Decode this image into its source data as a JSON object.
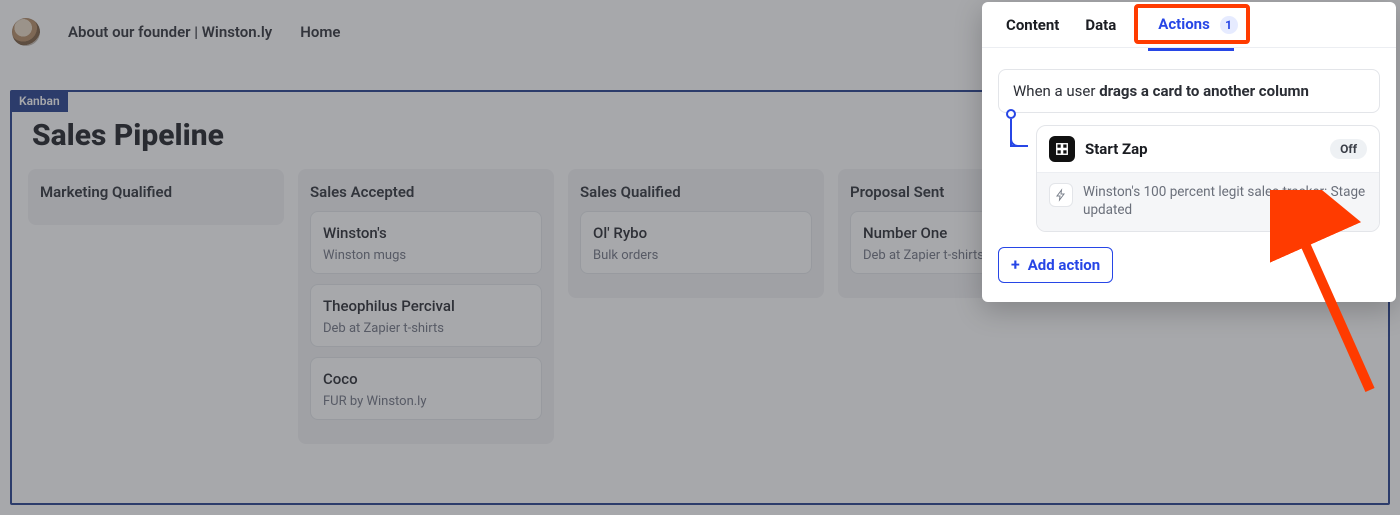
{
  "header": {
    "breadcrumb": "About our founder | Winston.ly",
    "home": "Home"
  },
  "board": {
    "tag": "Kanban",
    "title": "Sales Pipeline",
    "columns": [
      {
        "name": "Marketing Qualified",
        "cards": []
      },
      {
        "name": "Sales Accepted",
        "cards": [
          {
            "title": "Winston's",
            "sub": "Winston mugs"
          },
          {
            "title": "Theophilus Percival",
            "sub": "Deb at Zapier t-shirts"
          },
          {
            "title": "Coco",
            "sub": "FUR by Winston.ly"
          }
        ]
      },
      {
        "name": "Sales Qualified",
        "cards": [
          {
            "title": "Ol' Rybo",
            "sub": "Bulk orders"
          }
        ]
      },
      {
        "name": "Proposal Sent",
        "cards": [
          {
            "title": "Number One",
            "sub": "Deb at Zapier t-shirts"
          }
        ]
      }
    ]
  },
  "panel": {
    "tabs": {
      "content": "Content",
      "data": "Data",
      "actions": "Actions",
      "actions_count": "1"
    },
    "trigger_prefix": "When a user ",
    "trigger_bold": "drags a card to another column",
    "zap": {
      "title": "Start Zap",
      "status": "Off",
      "desc": "Winston's 100 percent legit sales tracker: Stage updated"
    },
    "add_action": "Add action"
  }
}
